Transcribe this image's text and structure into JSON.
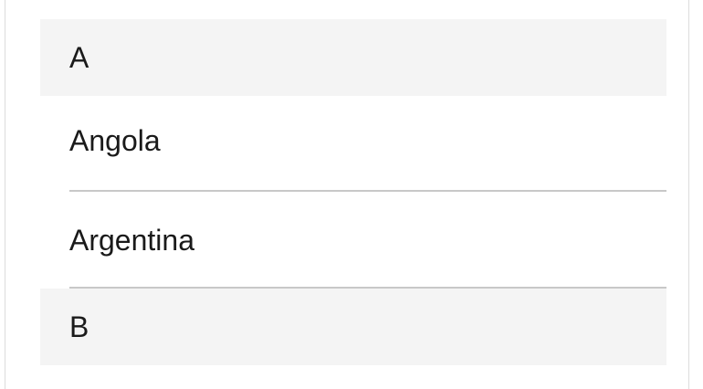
{
  "sections": [
    {
      "header": "A",
      "items": [
        "Angola",
        "Argentina"
      ]
    },
    {
      "header": "B",
      "items": []
    }
  ]
}
